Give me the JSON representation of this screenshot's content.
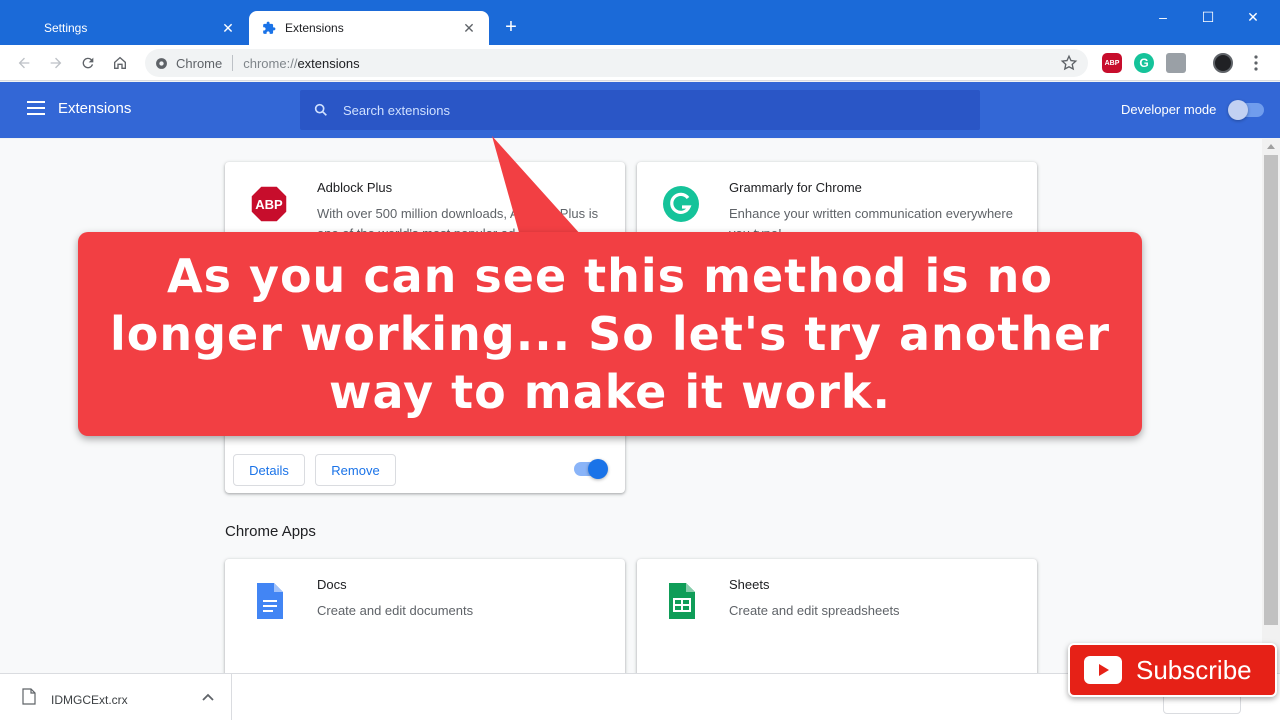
{
  "tabs": [
    {
      "label": "Settings",
      "active": false,
      "icon": "gear-icon"
    },
    {
      "label": "Extensions",
      "active": true,
      "icon": "puzzle-icon"
    }
  ],
  "omnibox": {
    "site_label": "Chrome",
    "url_scheme": "chrome://",
    "url_path": "extensions"
  },
  "toolbar_extensions": [
    {
      "name": "abp-extension-icon",
      "text": "ABP",
      "color": "#c70d2c"
    },
    {
      "name": "grammarly-extension-icon",
      "text": "G",
      "color": "#15c39a"
    },
    {
      "name": "generic-extension-icon",
      "text": "",
      "color": "#9aa0a6"
    },
    {
      "name": "profile-avatar",
      "text": "",
      "color": "#202124"
    }
  ],
  "header": {
    "title": "Extensions",
    "search_placeholder": "Search extensions",
    "developer_mode_label": "Developer mode",
    "developer_mode_on": false
  },
  "extensions": [
    {
      "name": "Adblock Plus",
      "description": "With over 500 million downloads, Adblock Plus is one of the world's most popular ad",
      "logo_text": "ABP",
      "logo_color": "#c70d2c",
      "details_label": "Details",
      "remove_label": "Remove",
      "enabled": true
    },
    {
      "name": "Grammarly for Chrome",
      "description": "Enhance your written communication everywhere you type!",
      "logo_text": "G",
      "logo_color": "#15c39a"
    }
  ],
  "apps_section_title": "Chrome Apps",
  "apps": [
    {
      "name": "Docs",
      "description": "Create and edit documents",
      "color": "#4285f4"
    },
    {
      "name": "Sheets",
      "description": "Create and edit spreadsheets",
      "color": "#0f9d58"
    }
  ],
  "overlay": {
    "text": "As you can see this method is no longer working... So let's try another way to make it work."
  },
  "download": {
    "filename": "IDMGCExt.crx"
  },
  "subscribe_label": "Subscribe"
}
